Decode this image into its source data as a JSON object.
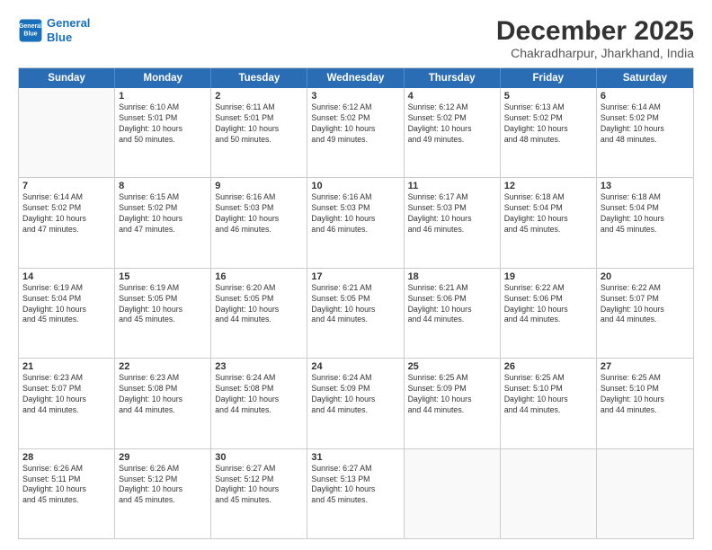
{
  "logo": {
    "line1": "General",
    "line2": "Blue"
  },
  "title": "December 2025",
  "subtitle": "Chakradharpur, Jharkhand, India",
  "days": [
    "Sunday",
    "Monday",
    "Tuesday",
    "Wednesday",
    "Thursday",
    "Friday",
    "Saturday"
  ],
  "weeks": [
    [
      {
        "day": "",
        "text": ""
      },
      {
        "day": "1",
        "text": "Sunrise: 6:10 AM\nSunset: 5:01 PM\nDaylight: 10 hours\nand 50 minutes."
      },
      {
        "day": "2",
        "text": "Sunrise: 6:11 AM\nSunset: 5:01 PM\nDaylight: 10 hours\nand 50 minutes."
      },
      {
        "day": "3",
        "text": "Sunrise: 6:12 AM\nSunset: 5:02 PM\nDaylight: 10 hours\nand 49 minutes."
      },
      {
        "day": "4",
        "text": "Sunrise: 6:12 AM\nSunset: 5:02 PM\nDaylight: 10 hours\nand 49 minutes."
      },
      {
        "day": "5",
        "text": "Sunrise: 6:13 AM\nSunset: 5:02 PM\nDaylight: 10 hours\nand 48 minutes."
      },
      {
        "day": "6",
        "text": "Sunrise: 6:14 AM\nSunset: 5:02 PM\nDaylight: 10 hours\nand 48 minutes."
      }
    ],
    [
      {
        "day": "7",
        "text": "Sunrise: 6:14 AM\nSunset: 5:02 PM\nDaylight: 10 hours\nand 47 minutes."
      },
      {
        "day": "8",
        "text": "Sunrise: 6:15 AM\nSunset: 5:02 PM\nDaylight: 10 hours\nand 47 minutes."
      },
      {
        "day": "9",
        "text": "Sunrise: 6:16 AM\nSunset: 5:03 PM\nDaylight: 10 hours\nand 46 minutes."
      },
      {
        "day": "10",
        "text": "Sunrise: 6:16 AM\nSunset: 5:03 PM\nDaylight: 10 hours\nand 46 minutes."
      },
      {
        "day": "11",
        "text": "Sunrise: 6:17 AM\nSunset: 5:03 PM\nDaylight: 10 hours\nand 46 minutes."
      },
      {
        "day": "12",
        "text": "Sunrise: 6:18 AM\nSunset: 5:04 PM\nDaylight: 10 hours\nand 45 minutes."
      },
      {
        "day": "13",
        "text": "Sunrise: 6:18 AM\nSunset: 5:04 PM\nDaylight: 10 hours\nand 45 minutes."
      }
    ],
    [
      {
        "day": "14",
        "text": "Sunrise: 6:19 AM\nSunset: 5:04 PM\nDaylight: 10 hours\nand 45 minutes."
      },
      {
        "day": "15",
        "text": "Sunrise: 6:19 AM\nSunset: 5:05 PM\nDaylight: 10 hours\nand 45 minutes."
      },
      {
        "day": "16",
        "text": "Sunrise: 6:20 AM\nSunset: 5:05 PM\nDaylight: 10 hours\nand 44 minutes."
      },
      {
        "day": "17",
        "text": "Sunrise: 6:21 AM\nSunset: 5:05 PM\nDaylight: 10 hours\nand 44 minutes."
      },
      {
        "day": "18",
        "text": "Sunrise: 6:21 AM\nSunset: 5:06 PM\nDaylight: 10 hours\nand 44 minutes."
      },
      {
        "day": "19",
        "text": "Sunrise: 6:22 AM\nSunset: 5:06 PM\nDaylight: 10 hours\nand 44 minutes."
      },
      {
        "day": "20",
        "text": "Sunrise: 6:22 AM\nSunset: 5:07 PM\nDaylight: 10 hours\nand 44 minutes."
      }
    ],
    [
      {
        "day": "21",
        "text": "Sunrise: 6:23 AM\nSunset: 5:07 PM\nDaylight: 10 hours\nand 44 minutes."
      },
      {
        "day": "22",
        "text": "Sunrise: 6:23 AM\nSunset: 5:08 PM\nDaylight: 10 hours\nand 44 minutes."
      },
      {
        "day": "23",
        "text": "Sunrise: 6:24 AM\nSunset: 5:08 PM\nDaylight: 10 hours\nand 44 minutes."
      },
      {
        "day": "24",
        "text": "Sunrise: 6:24 AM\nSunset: 5:09 PM\nDaylight: 10 hours\nand 44 minutes."
      },
      {
        "day": "25",
        "text": "Sunrise: 6:25 AM\nSunset: 5:09 PM\nDaylight: 10 hours\nand 44 minutes."
      },
      {
        "day": "26",
        "text": "Sunrise: 6:25 AM\nSunset: 5:10 PM\nDaylight: 10 hours\nand 44 minutes."
      },
      {
        "day": "27",
        "text": "Sunrise: 6:25 AM\nSunset: 5:10 PM\nDaylight: 10 hours\nand 44 minutes."
      }
    ],
    [
      {
        "day": "28",
        "text": "Sunrise: 6:26 AM\nSunset: 5:11 PM\nDaylight: 10 hours\nand 45 minutes."
      },
      {
        "day": "29",
        "text": "Sunrise: 6:26 AM\nSunset: 5:12 PM\nDaylight: 10 hours\nand 45 minutes."
      },
      {
        "day": "30",
        "text": "Sunrise: 6:27 AM\nSunset: 5:12 PM\nDaylight: 10 hours\nand 45 minutes."
      },
      {
        "day": "31",
        "text": "Sunrise: 6:27 AM\nSunset: 5:13 PM\nDaylight: 10 hours\nand 45 minutes."
      },
      {
        "day": "",
        "text": ""
      },
      {
        "day": "",
        "text": ""
      },
      {
        "day": "",
        "text": ""
      }
    ]
  ]
}
